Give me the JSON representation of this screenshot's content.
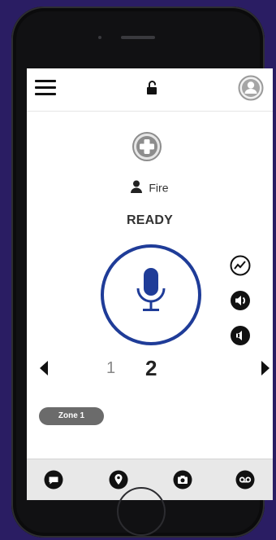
{
  "header": {
    "menu_icon": "hamburger-menu-icon",
    "lock_icon": "unlocked-padlock-icon",
    "avatar_icon": "user-avatar-icon"
  },
  "channel": {
    "icon": "medical-cross-icon",
    "group_icon": "person-icon",
    "group_name": "Fire",
    "status": "READY"
  },
  "ptt": {
    "icon": "microphone-icon",
    "accent": "#1f3c98"
  },
  "side_controls": [
    {
      "icon": "activity-graph-icon"
    },
    {
      "icon": "speaker-volume-icon"
    },
    {
      "icon": "speaker-alt-icon"
    }
  ],
  "pager": {
    "pages": [
      "1",
      "2"
    ],
    "current": "2"
  },
  "zone": {
    "label": "Zone 1"
  },
  "bottom_nav": [
    {
      "icon": "chat-bubble-icon"
    },
    {
      "icon": "location-pin-icon"
    },
    {
      "icon": "camera-icon"
    },
    {
      "icon": "voicemail-icon"
    }
  ],
  "colors": {
    "background": "#2a1d63",
    "phone": "#111113",
    "accent": "#1f3c98",
    "badge": "#6b6b6b"
  }
}
